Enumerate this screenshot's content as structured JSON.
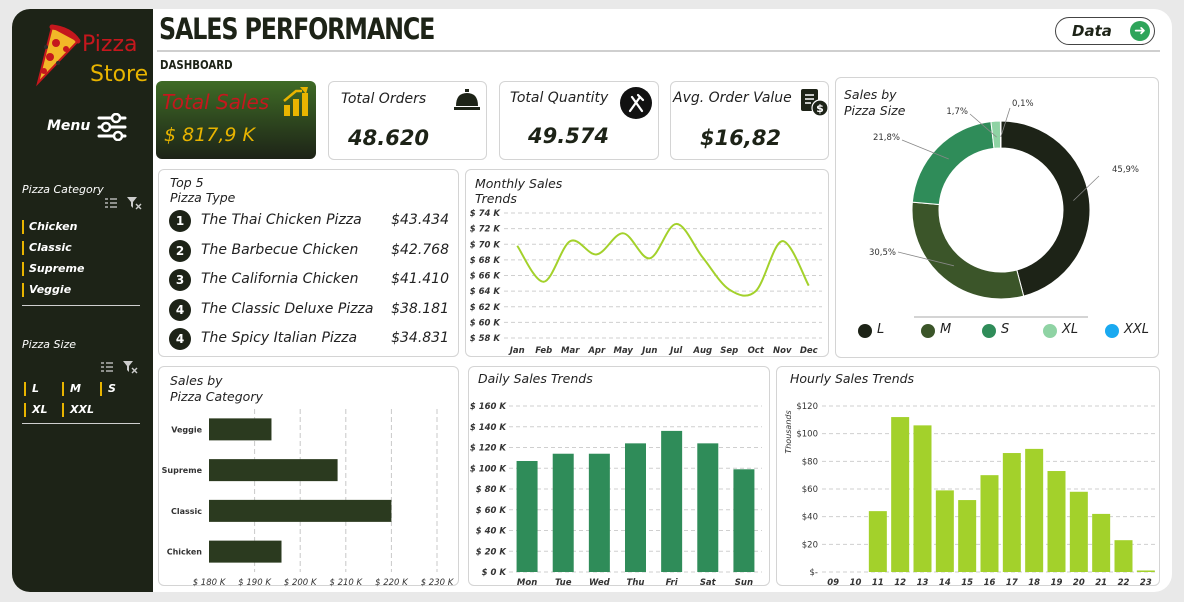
{
  "brand": {
    "line1": "Pizza",
    "line2": "Store",
    "color1": "#c5171d",
    "color2": "#e8b400"
  },
  "sidebar": {
    "menu_label": "Menu",
    "category_title": "Pizza Category",
    "categories": [
      "Chicken",
      "Classic",
      "Supreme",
      "Veggie"
    ],
    "size_title": "Pizza Size",
    "sizes": [
      "L",
      "M",
      "S",
      "XL",
      "XXL"
    ]
  },
  "header": {
    "title": "SALES PERFORMANCE",
    "subtitle": "DASHBOARD",
    "data_button": "Data"
  },
  "kpis": {
    "total_sales": {
      "label": "Total Sales",
      "value": "$ 817,9 K"
    },
    "total_orders": {
      "label": "Total Orders",
      "value": "48.620"
    },
    "total_quantity": {
      "label": "Total Quantity",
      "value": "49.574"
    },
    "avg_order_value": {
      "label": "Avg. Order Value",
      "value": "$16,82"
    }
  },
  "top5": {
    "title_line1": "Top 5",
    "title_line2": "Pizza Type",
    "items": [
      {
        "rank": "1",
        "name": "The Thai Chicken Pizza",
        "value": "$43.434"
      },
      {
        "rank": "2",
        "name": "The Barbecue Chicken",
        "value": "$42.768"
      },
      {
        "rank": "3",
        "name": "The California Chicken",
        "value": "$41.410"
      },
      {
        "rank": "4",
        "name": "The Classic Deluxe Pizza",
        "value": "$38.181"
      },
      {
        "rank": "4",
        "name": "The Spicy Italian Pizza",
        "value": "$34.831"
      }
    ]
  },
  "colors": {
    "dark": "#1d2317",
    "lime": "#a3d12b",
    "green": "#2f8c59",
    "mid": "#3b5529",
    "light": "#8fd3a4",
    "blue": "#1aa9f0"
  },
  "chart_data": [
    {
      "id": "monthly",
      "type": "line",
      "title": "Monthly Sales Trends",
      "title_line1": "Monthly Sales",
      "title_line2": "Trends",
      "categories": [
        "Jan",
        "Feb",
        "Mar",
        "Apr",
        "May",
        "Jun",
        "Jul",
        "Aug",
        "Sep",
        "Oct",
        "Nov",
        "Dec"
      ],
      "values": [
        69.8,
        65.2,
        70.4,
        68.7,
        71.4,
        68.2,
        72.6,
        68.3,
        64.2,
        64.0,
        70.4,
        64.7
      ],
      "ylim": [
        58,
        74
      ],
      "yticks": [
        "$ 58 K",
        "$ 60 K",
        "$ 62 K",
        "$ 64 K",
        "$ 66 K",
        "$ 68 K",
        "$ 70 K",
        "$ 72 K",
        "$ 74 K"
      ],
      "grid": true
    },
    {
      "id": "size",
      "type": "pie",
      "title_line1": "Sales by",
      "title_line2": "Pizza Size",
      "categories": [
        "L",
        "M",
        "S",
        "XL",
        "XXL"
      ],
      "values": [
        45.9,
        30.5,
        21.8,
        1.7,
        0.1
      ],
      "labels": [
        "45,9%",
        "30,5%",
        "21,8%",
        "1,7%",
        "0,1%"
      ],
      "legend": "bottom"
    },
    {
      "id": "category",
      "type": "bar",
      "orientation": "horizontal",
      "title_line1": "Sales by",
      "title_line2": "Pizza Category",
      "categories": [
        "Veggie",
        "Supreme",
        "Classic",
        "Chicken"
      ],
      "values": [
        193.7,
        208.2,
        220.0,
        195.9
      ],
      "xlim": [
        180,
        230
      ],
      "xticks": [
        "$ 180 K",
        "$ 190 K",
        "$ 200 K",
        "$ 210 K",
        "$ 220 K",
        "$ 230 K"
      ],
      "grid": true
    },
    {
      "id": "daily",
      "type": "bar",
      "title": "Daily Sales Trends",
      "categories": [
        "Mon",
        "Tue",
        "Wed",
        "Thu",
        "Fri",
        "Sat",
        "Sun"
      ],
      "values": [
        107,
        114,
        114,
        124,
        136,
        124,
        99
      ],
      "ylim": [
        0,
        160
      ],
      "yticks": [
        "$ 0 K",
        "$ 20 K",
        "$ 40 K",
        "$ 60 K",
        "$ 80 K",
        "$ 100 K",
        "$ 120 K",
        "$ 140 K",
        "$ 160 K"
      ],
      "grid": true
    },
    {
      "id": "hourly",
      "type": "bar",
      "title": "Hourly Sales Trends",
      "ylabel": "Thousands",
      "categories": [
        "09",
        "10",
        "11",
        "12",
        "13",
        "14",
        "15",
        "16",
        "17",
        "18",
        "19",
        "20",
        "21",
        "22",
        "23"
      ],
      "values": [
        0,
        0,
        44,
        112,
        106,
        59,
        52,
        70,
        86,
        89,
        73,
        58,
        42,
        23,
        1.1
      ],
      "ylim": [
        0,
        120
      ],
      "yticks": [
        "$-",
        "$20",
        "$40",
        "$60",
        "$80",
        "$100",
        "$120"
      ],
      "grid": true
    }
  ]
}
